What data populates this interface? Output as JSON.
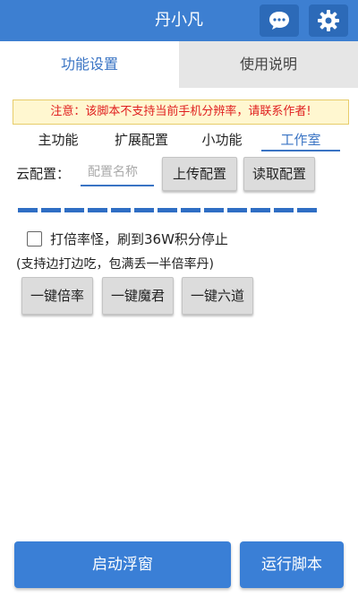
{
  "header": {
    "title": "丹小凡",
    "icons": [
      "chat-icon",
      "gear-icon"
    ],
    "color": "#3d7fd1"
  },
  "tabs": [
    {
      "label": "功能设置",
      "active": true
    },
    {
      "label": "使用说明",
      "active": false
    }
  ],
  "notice": "注意：该脚本不支持当前手机分辨率，请联系作者!",
  "subtabs": [
    {
      "label": "主功能",
      "active": false
    },
    {
      "label": "扩展配置",
      "active": false
    },
    {
      "label": "小功能",
      "active": false
    },
    {
      "label": "工作室",
      "active": true
    }
  ],
  "cloud": {
    "label": "云配置：",
    "placeholder": "配置名称",
    "value": "",
    "upload_label": "上传配置",
    "read_label": "读取配置"
  },
  "progress": {
    "segments": 13,
    "filled": 13
  },
  "option": {
    "label": "打倍率怪，刷到36W积分停止",
    "checked": false
  },
  "hint": "(支持边打边吃，包满丢一半倍率丹)",
  "quick_buttons": [
    "一键倍率",
    "一键魔君",
    "一键六道"
  ],
  "footer": {
    "float_label": "启动浮窗",
    "run_label": "运行脚本",
    "color": "#3a7fd6"
  }
}
